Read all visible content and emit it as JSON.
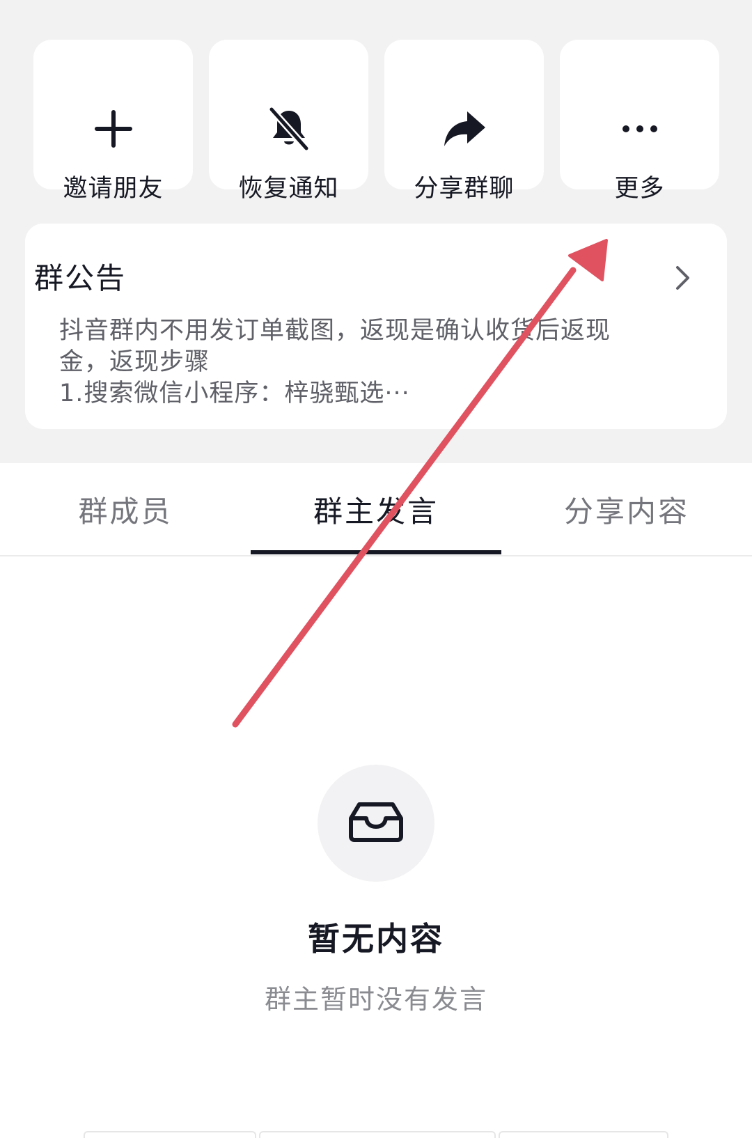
{
  "actions": [
    {
      "label": "邀请朋友",
      "icon": "plus-icon"
    },
    {
      "label": "恢复通知",
      "icon": "bell-muted-icon"
    },
    {
      "label": "分享群聊",
      "icon": "share-arrow-icon"
    },
    {
      "label": "更多",
      "icon": "more-dots-icon"
    }
  ],
  "notice": {
    "title": "群公告",
    "lines": [
      "抖音群内不用发订单截图，返现是确认收货后返现",
      "金，返现步骤",
      "1.搜索微信小程序：梓骁甄选···"
    ],
    "chevron_icon": "chevron-right-icon"
  },
  "tabs": [
    {
      "label": "群成员",
      "active": false
    },
    {
      "label": "群主发言",
      "active": true
    },
    {
      "label": "分享内容",
      "active": false
    }
  ],
  "empty_state": {
    "icon": "inbox-tray-icon",
    "title": "暂无内容",
    "subtitle": "群主暂时没有发言"
  },
  "annotation": {
    "type": "arrow",
    "color": "#e05260"
  },
  "colors": {
    "background_top": "#f2f2f2",
    "card": "#ffffff",
    "text_primary": "#161823",
    "text_secondary": "#5f6068",
    "tab_inactive": "#75767d",
    "empty_subtitle": "#8a8b91"
  }
}
